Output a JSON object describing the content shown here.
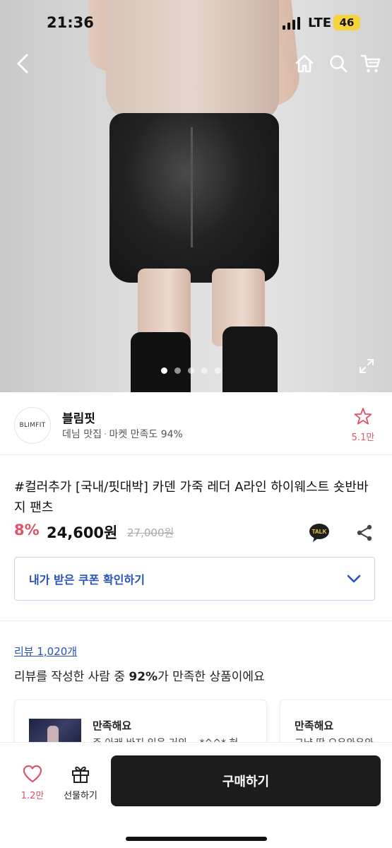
{
  "status_bar": {
    "time": "21:36",
    "network": "LTE",
    "battery": "46"
  },
  "hero": {
    "icons": {
      "back": "chevron-left-icon",
      "home": "home-icon",
      "search": "search-icon",
      "cart": "cart-icon",
      "expand": "expand-icon"
    },
    "dots_total": 5,
    "dots_active": 1
  },
  "shop": {
    "logo_text": "BLIMFIT",
    "name": "블림핏",
    "category": "데님 맛집",
    "satisfaction": "마켓 만족도 94%",
    "favorite_count": "5.1만"
  },
  "product": {
    "title": "#컬러추가 [국내/핏대박] 카덴 가죽 레더 A라인 하이웨스트 숏반바지 팬츠",
    "discount": "8%",
    "price": "24,600원",
    "original_price": "27,000원",
    "talk_label": "TALK"
  },
  "coupon": {
    "label": "내가 받은 쿠폰 확인하기"
  },
  "reviews": {
    "link": "리뷰 1,020개",
    "summary_prefix": "리뷰를 작성한 사람 중 ",
    "summary_pct": "92%",
    "summary_suffix": "가 만족한 상품이에요",
    "cards": [
      {
        "title": "만족해요",
        "body": "주 아래 바지 있은 거의 ...*^^* 혀"
      },
      {
        "title": "만족해요",
        "body": "그냥 딱 오우와우와"
      }
    ]
  },
  "bottom": {
    "like_count": "1.2만",
    "gift_label": "선물하기",
    "buy_label": "구매하기"
  },
  "colors": {
    "accent_red": "#e0526a",
    "link_blue": "#2852b8",
    "buy_button": "#1c1c1c",
    "battery": "#f5d33b"
  }
}
